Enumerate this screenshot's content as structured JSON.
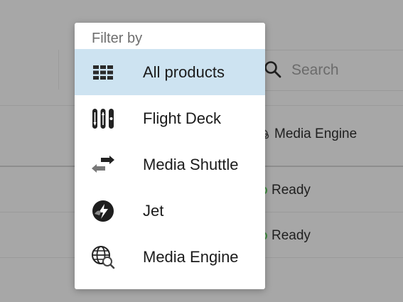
{
  "search": {
    "placeholder": "Search"
  },
  "background_rows": [
    {
      "product": "Media Engine"
    },
    {
      "status": "Ready"
    },
    {
      "status": "Ready"
    }
  ],
  "filter_menu": {
    "header": "Filter by",
    "items": [
      {
        "label": "All products",
        "icon": "grid-icon",
        "selected": true
      },
      {
        "label": "Flight Deck",
        "icon": "flight-deck-icon",
        "selected": false
      },
      {
        "label": "Media Shuttle",
        "icon": "media-shuttle-icon",
        "selected": false
      },
      {
        "label": "Jet",
        "icon": "jet-icon",
        "selected": false
      },
      {
        "label": "Media Engine",
        "icon": "media-engine-icon",
        "selected": false
      }
    ]
  },
  "colors": {
    "overlay_background": "#a7a7a7",
    "menu_background": "#ffffff",
    "selected_item": "#cde3f1",
    "status_ready": "#3f8d3f"
  }
}
